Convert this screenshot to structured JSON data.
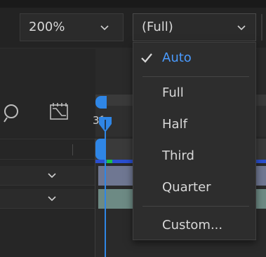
{
  "toolbar": {
    "zoom": {
      "value": "200%",
      "icon": "chevron-down-icon"
    },
    "resolution": {
      "value": "(Full)",
      "icon": "chevron-down-icon"
    }
  },
  "timeline": {
    "current_time_label": "3f",
    "icons": [
      "light-bulb-icon",
      "graph-editor-icon",
      "playhead-icon"
    ]
  },
  "resolution_menu": {
    "items": [
      {
        "label": "Auto",
        "checked": true
      },
      {
        "label": "Full",
        "checked": false
      },
      {
        "label": "Half",
        "checked": false
      },
      {
        "label": "Third",
        "checked": false
      },
      {
        "label": "Quarter",
        "checked": false
      },
      {
        "label": "Custom...",
        "checked": false
      }
    ]
  },
  "colors": {
    "accent": "#2f86e6",
    "selected_text": "#4a9bff",
    "layer_1": "#6f7792",
    "layer_2": "#6d8a84",
    "work_area": "#2a4fd0"
  }
}
